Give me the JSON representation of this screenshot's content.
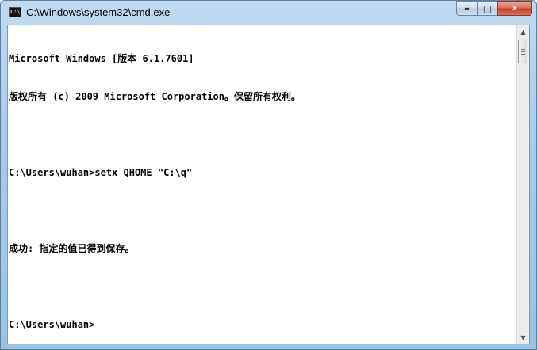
{
  "window": {
    "title": "C:\\Windows\\system32\\cmd.exe",
    "icon_label": "C:\\"
  },
  "caption_buttons": {
    "minimize": "▬",
    "maximize": "□",
    "close": "✕"
  },
  "console": {
    "lines": [
      "Microsoft Windows [版本 6.1.7601]",
      "版权所有 (c) 2009 Microsoft Corporation。保留所有权利。",
      "",
      "C:\\Users\\wuhan>setx QHOME \"C:\\q\"",
      "",
      "成功: 指定的值已得到保存。",
      "",
      "C:\\Users\\wuhan>"
    ]
  },
  "scrollbar": {
    "up_arrow": "▲",
    "down_arrow": "▼"
  }
}
